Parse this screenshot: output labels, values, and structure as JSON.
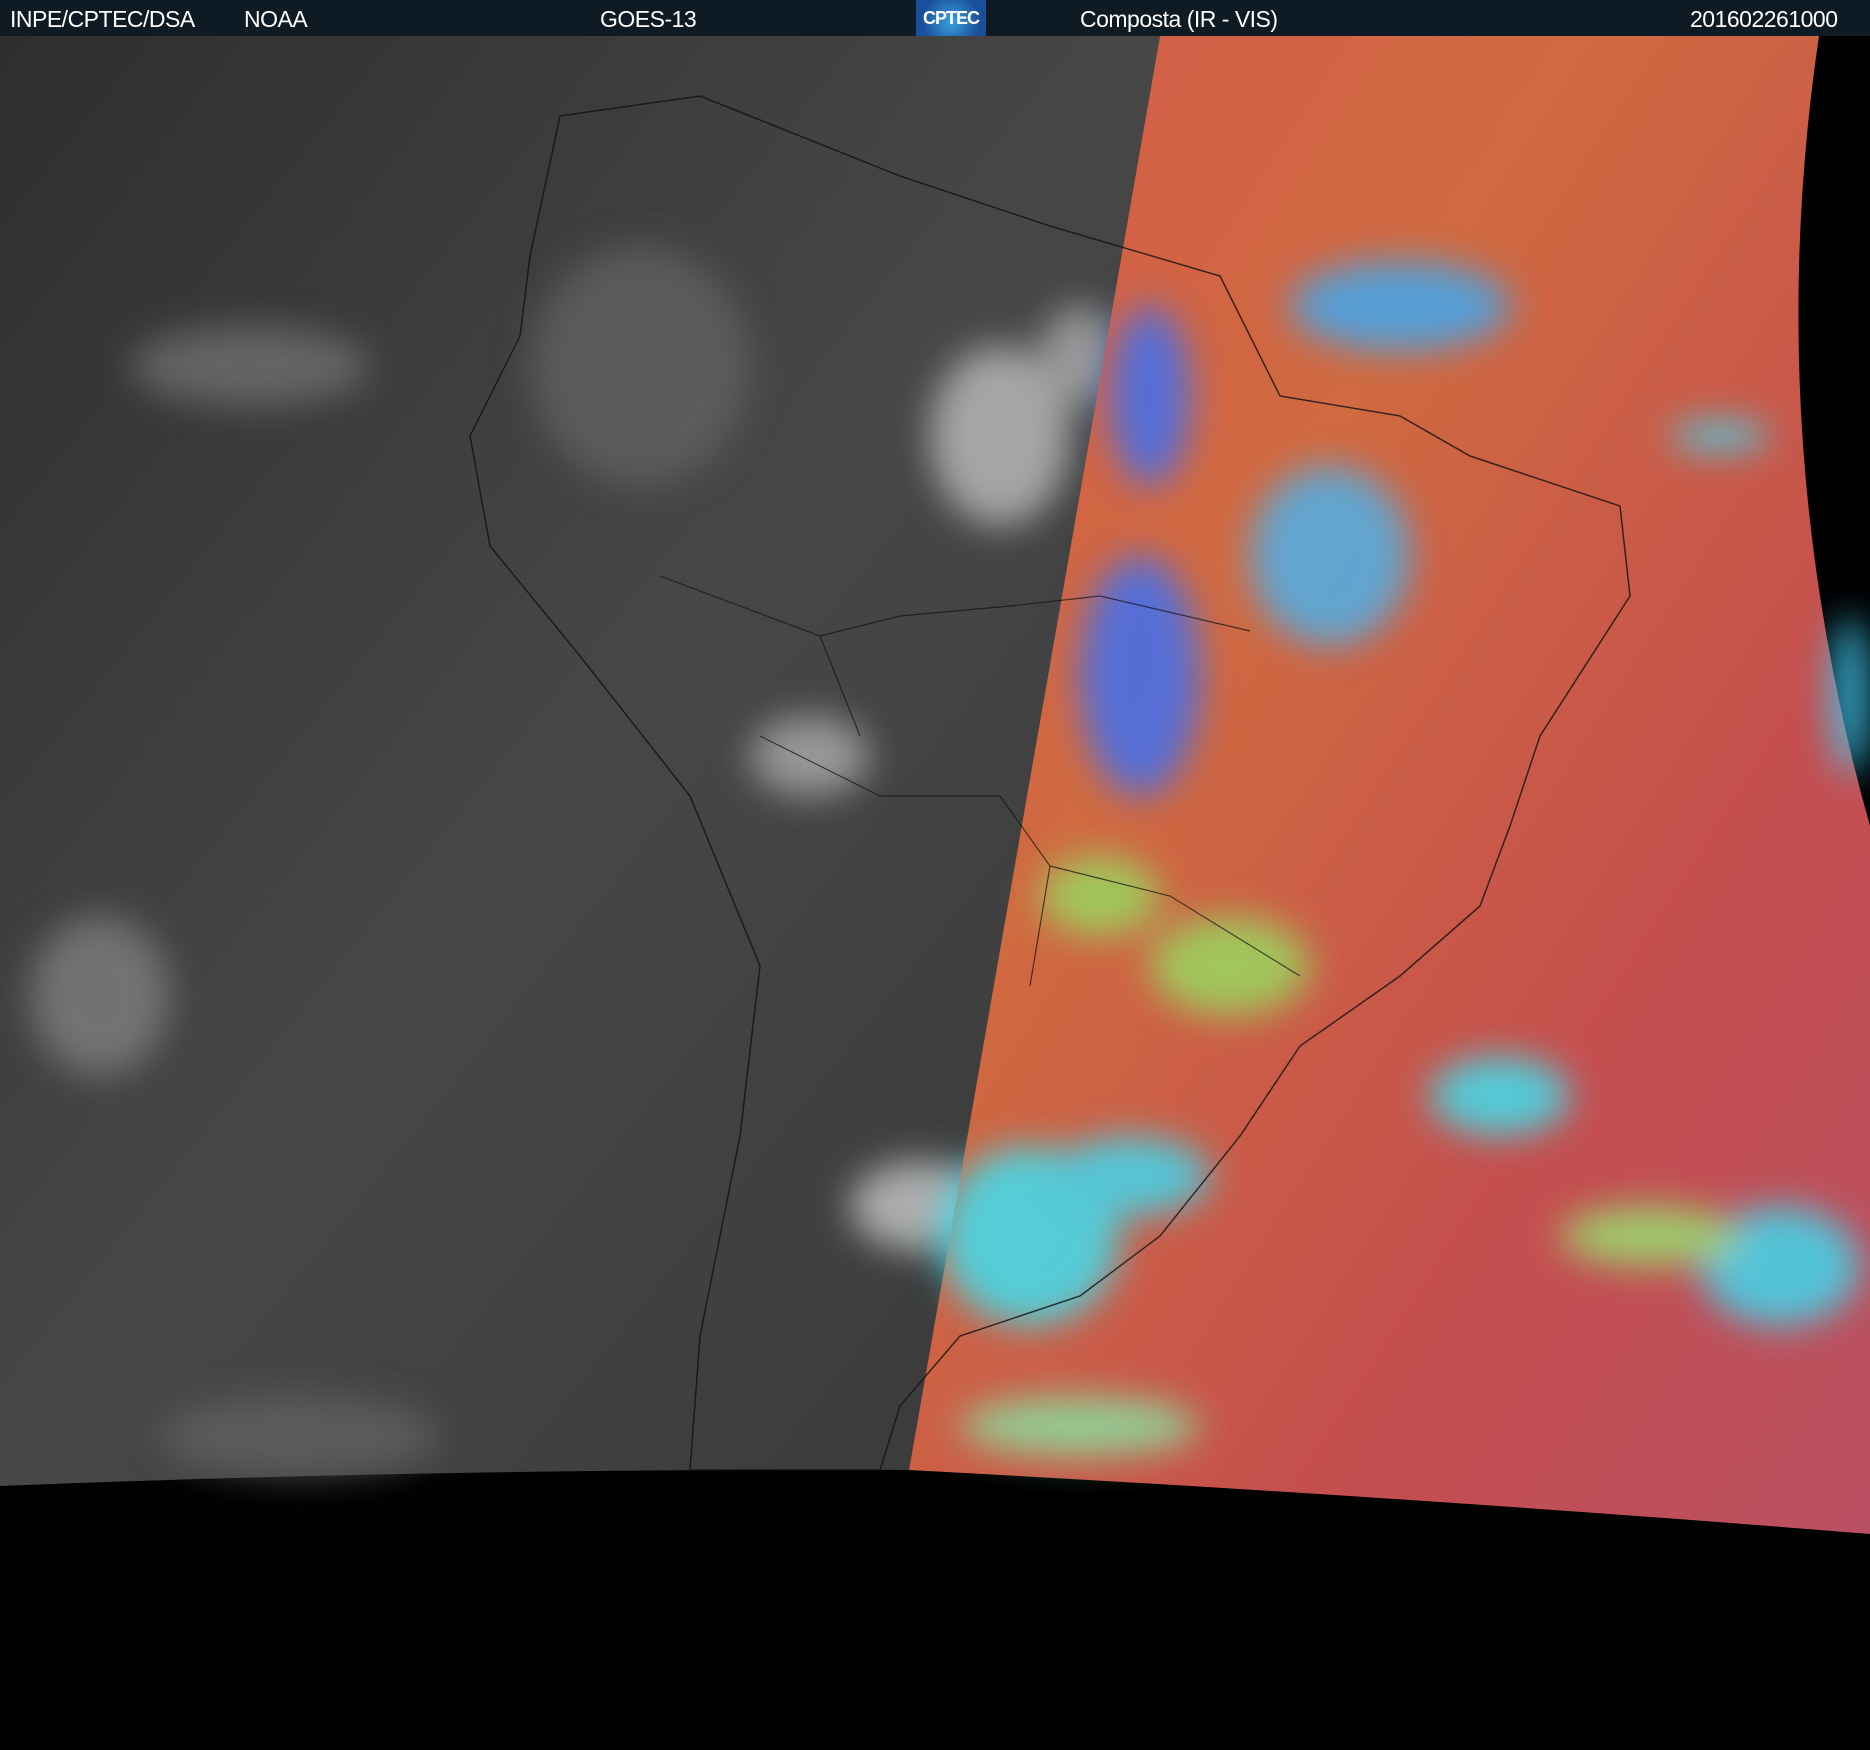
{
  "header": {
    "institution": "INPE/CPTEC/DSA",
    "agency": "NOAA",
    "satellite": "GOES-13",
    "logo_text": "CPTEC",
    "product": "Composta (IR - VIS)",
    "timestamp": "201602261000"
  },
  "colors": {
    "header_bg": "#0f1b24",
    "ir_gray": "#3a3a3a",
    "vis_red": "#c8564a",
    "vis_orange": "#e07a3c",
    "cloud_cyan": "#3fd8f0",
    "cloud_blue": "#3f6ff0"
  }
}
